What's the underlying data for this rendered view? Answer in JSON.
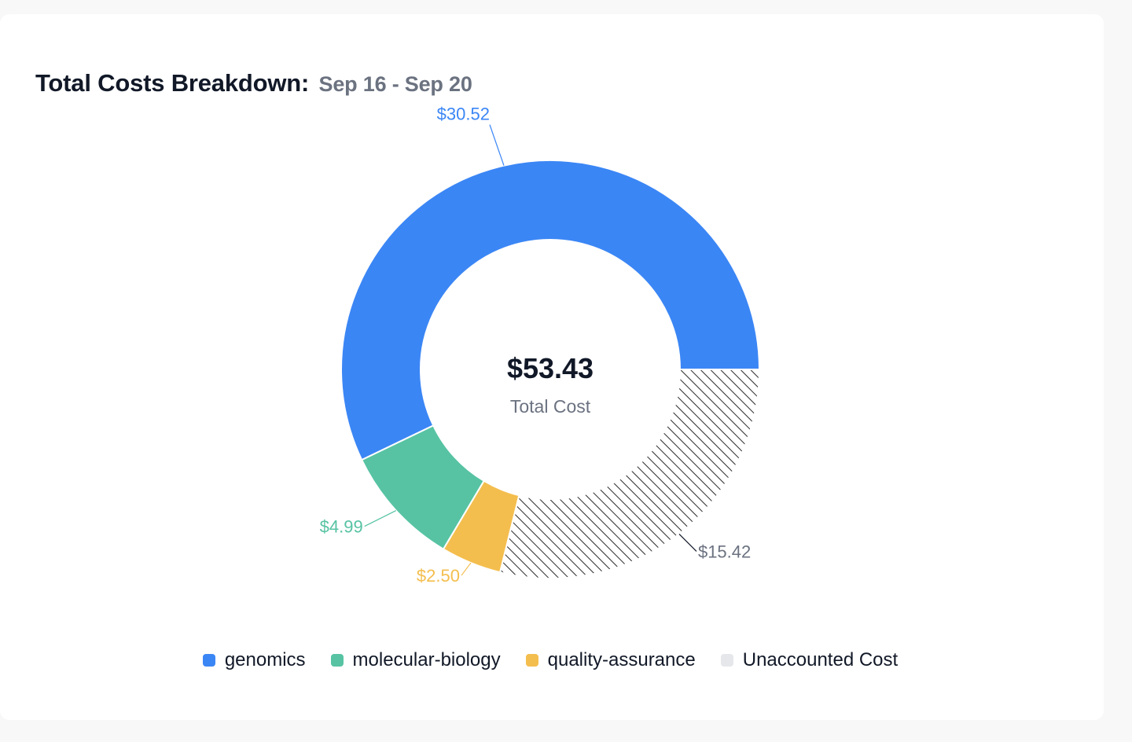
{
  "header": {
    "title": "Total Costs Breakdown:",
    "date_range": "Sep 16 - Sep 20"
  },
  "center": {
    "value": "$53.43",
    "label": "Total Cost"
  },
  "chart_data": {
    "type": "pie",
    "title": "Total Costs Breakdown:",
    "subtitle": "Sep 16 - Sep 20",
    "total": 53.43,
    "legend_position": "bottom",
    "slices": [
      {
        "name": "genomics",
        "value": 30.52,
        "label": "$30.52",
        "color": "#3b86f5"
      },
      {
        "name": "molecular-biology",
        "value": 4.99,
        "label": "$4.99",
        "color": "#57c3a3"
      },
      {
        "name": "quality-assurance",
        "value": 2.5,
        "label": "$2.50",
        "color": "#f4be4e"
      },
      {
        "name": "Unaccounted Cost",
        "value": 15.42,
        "label": "$15.42",
        "color": "#e5e7eb",
        "pattern": "hatched",
        "label_color": "#6b7280"
      }
    ]
  }
}
